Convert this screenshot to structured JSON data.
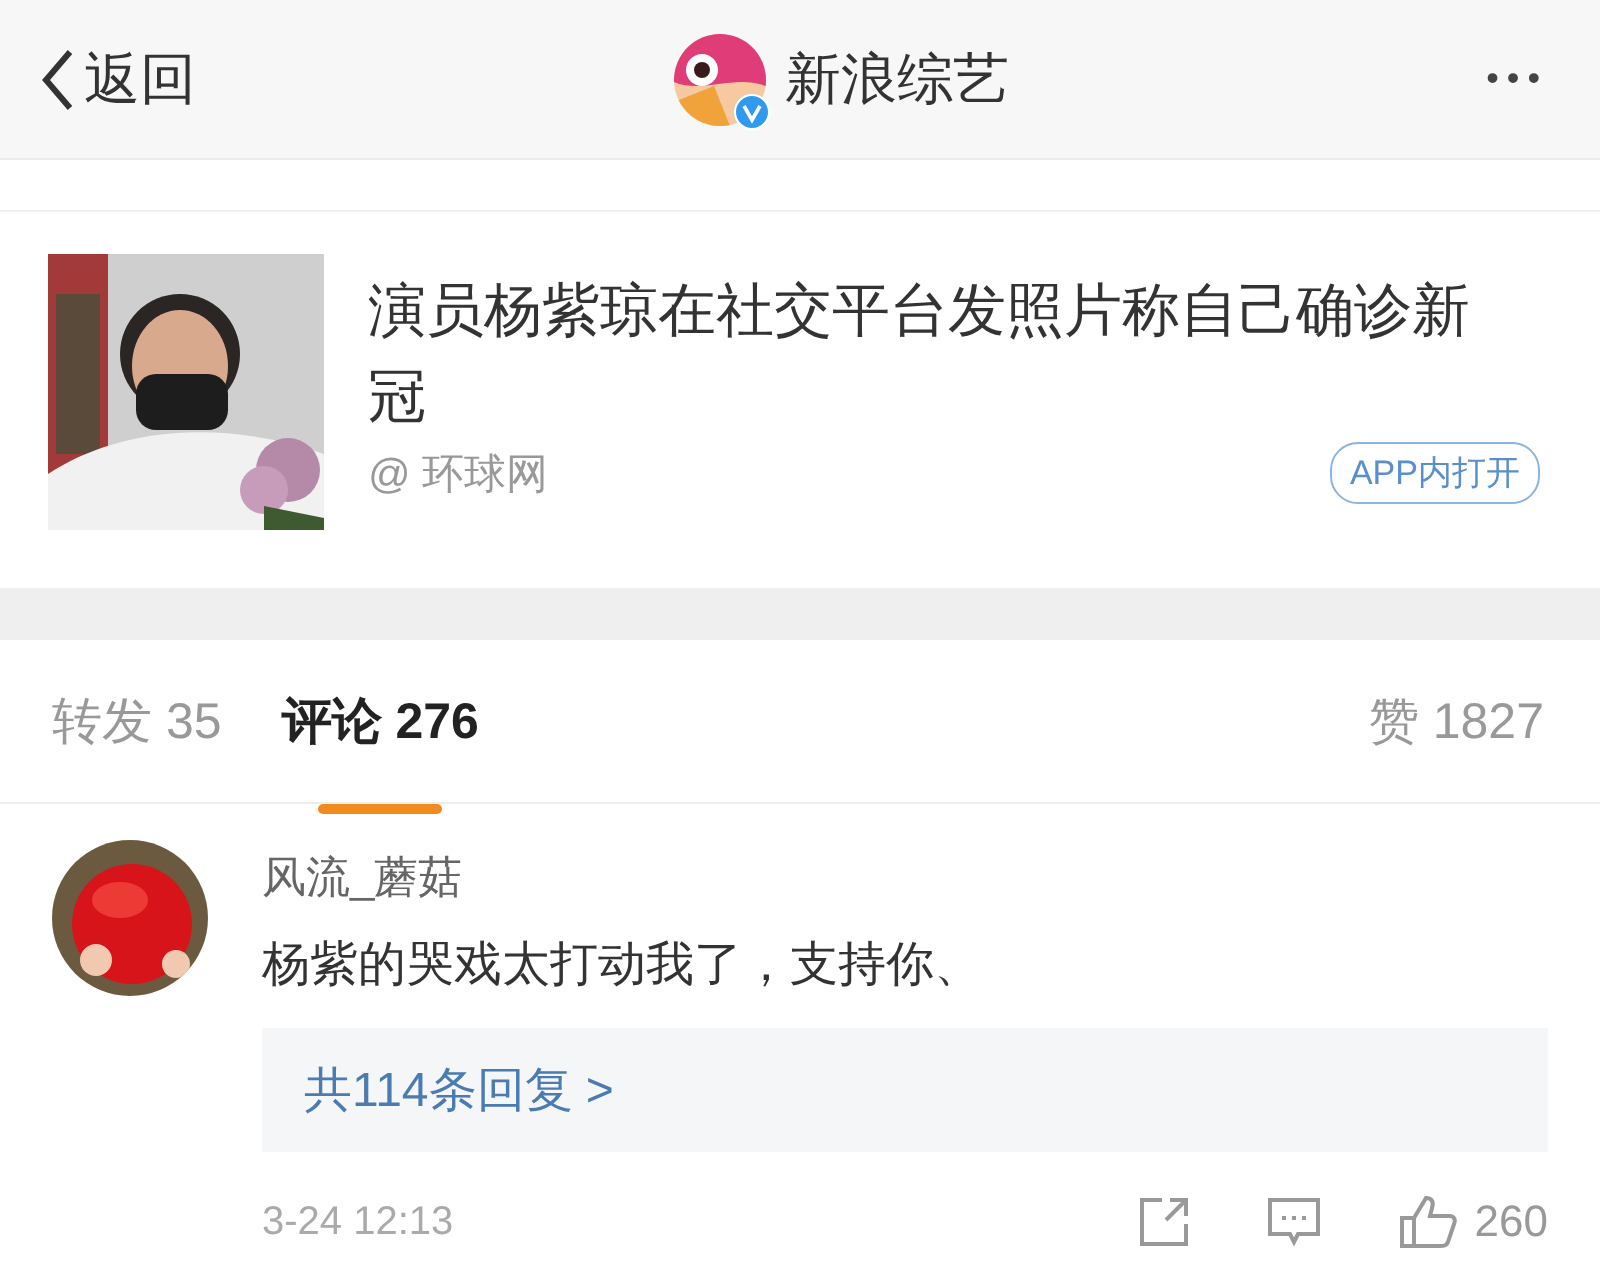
{
  "header": {
    "back_label": "返回",
    "account_name": "新浪综艺",
    "verified": true,
    "more": "•••"
  },
  "article": {
    "title": "演员杨紫琼在社交平台发照片称自己确诊新冠",
    "source": "@ 环球网",
    "open_button": "APP内打开"
  },
  "tabs": [
    {
      "label": "转发",
      "count": "35",
      "selected": false
    },
    {
      "label": "评论",
      "count": "276",
      "selected": true
    }
  ],
  "likes": {
    "label": "赞",
    "count": "1827"
  },
  "comments": [
    {
      "user": "风流_蘑菇",
      "text": "杨紫的哭戏太打动我了，支持你、",
      "replies": "共114条回复 >",
      "time": "3-24 12:13",
      "like_count": "260"
    }
  ]
}
